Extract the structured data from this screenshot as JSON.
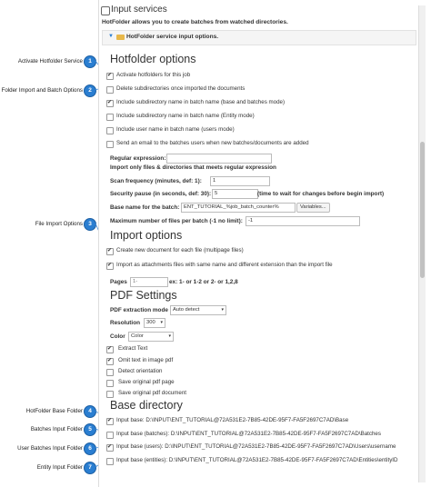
{
  "header": {
    "title": "Input services",
    "subtitle": "HotFolder allows you to create batches from watched directories.",
    "section_toggle": "HotFolder service input options."
  },
  "callouts": [
    {
      "num": "1",
      "label": "Activate Hotfolder Service"
    },
    {
      "num": "2",
      "label": "Folder Import and Batch Options"
    },
    {
      "num": "3",
      "label": "File Import Options"
    },
    {
      "num": "4",
      "label": "HotFolder Base Folder"
    },
    {
      "num": "5",
      "label": "Batches Input Folder"
    },
    {
      "num": "6",
      "label": "User Batches Input Folder"
    },
    {
      "num": "7",
      "label": "Entity Input Folder"
    }
  ],
  "hotfolder_options": {
    "heading": "Hotfolder options",
    "checkboxes": [
      {
        "label": "Activate hotfolders for this job",
        "checked": true
      },
      {
        "label": "Delete subdirectories once imported the documents",
        "checked": false
      },
      {
        "label": "Include subdirectory name in batch name (base and batches mode)",
        "checked": true
      },
      {
        "label": "Include subdirectory name in batch name (Entity mode)",
        "checked": false
      },
      {
        "label": "Include user name in batch name (users mode)",
        "checked": false
      },
      {
        "label": "Send an email to the batches users when new batches/documents are added",
        "checked": false
      }
    ],
    "regex_label": "Regular expression:",
    "regex_value": "",
    "regex_help": "Import only files & directories that meets regular expression",
    "scan_label": "Scan frequency (minutes, def: 1):",
    "scan_value": "1",
    "pause_label": "Security pause (in seconds, def: 30):",
    "pause_value": "5",
    "pause_help": "(time to wait for changes before begin import)",
    "batchname_label": "Base name for the batch:",
    "batchname_value": "ENT_TUTORIAL_%job_batch_counter%",
    "variables_button": "Variables...",
    "maxfiles_label": "Maximum number of files per batch (-1 no limit):",
    "maxfiles_value": "-1"
  },
  "import_options": {
    "heading": "Import options",
    "checkboxes": [
      {
        "label": "Create new document for each file (multipage files)",
        "checked": true
      },
      {
        "label": "Import as attachments files with same name and different extension than the import file",
        "checked": true
      }
    ],
    "pages_label": "Pages",
    "pages_placeholder": "1-",
    "pages_help": "ex: 1- or 1-2 or 2- or 1,2,8"
  },
  "pdf_settings": {
    "heading": "PDF Settings",
    "extraction_label": "PDF extraction mode",
    "extraction_value": "Auto detect",
    "resolution_label": "Resolution",
    "resolution_value": "300",
    "color_label": "Color",
    "color_value": "Color",
    "checkboxes": [
      {
        "label": "Extract Text",
        "checked": true
      },
      {
        "label": "Omit text in image pdf",
        "checked": true
      },
      {
        "label": "Detect orientation",
        "checked": false
      },
      {
        "label": "Save original pdf page",
        "checked": false
      },
      {
        "label": "Save original pdf document",
        "checked": false
      }
    ]
  },
  "base_directory": {
    "heading": "Base directory",
    "checkboxes": [
      {
        "label": "Input base: D:\\INPUT\\ENT_TUTORIAL@72A531E2-7B85-42DE-95F7-FA5F2697C7AD\\Base",
        "checked": true
      },
      {
        "label": "Input base (batches): D:\\INPUT\\ENT_TUTORIAL@72A531E2-7B85-42DE-95F7-FA5F2697C7AD\\Batches",
        "checked": false
      },
      {
        "label": "Input base (users): D:\\INPUT\\ENT_TUTORIAL@72A531E2-7B85-42DE-95F7-FA5F2697C7AD\\Users\\username",
        "checked": true
      },
      {
        "label": "Input base (entities): D:\\INPUT\\ENT_TUTORIAL@72A531E2-7B85-42DE-95F7-FA5F2697C7AD\\Entities\\entityID",
        "checked": false
      }
    ]
  },
  "colors": {
    "accent": "#2a7ed1",
    "folder": "#e8b84a"
  }
}
